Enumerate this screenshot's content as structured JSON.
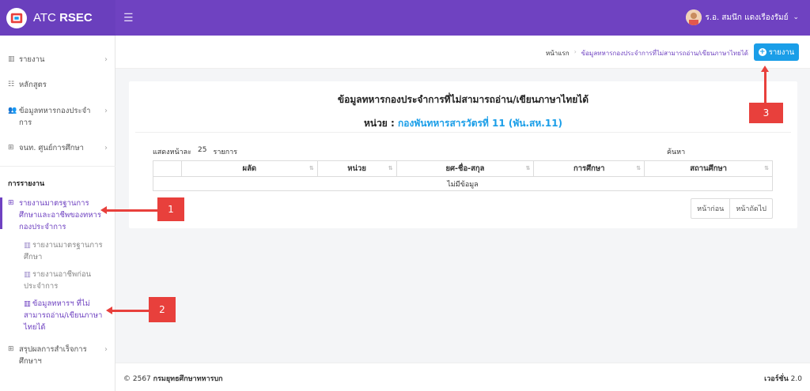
{
  "brand": {
    "name_prefix": "ATC ",
    "name_bold": "RSEC"
  },
  "user": {
    "name": "ร.อ. สมนึก แดงเรืองรัมย์"
  },
  "sidebar": {
    "items": [
      {
        "label": "รายงาน"
      },
      {
        "label": "หลักสูตร"
      },
      {
        "label": "ข้อมูลทหารกองประจำการ"
      },
      {
        "label": "จนท. ศูนย์การศึกษา"
      }
    ],
    "section_title": "การรายงาน",
    "active_item": "รายงานมาตรฐานการศึกษาและอาชีพของทหารกองประจำการ",
    "sub_items": [
      {
        "label": "รายงานมาตรฐานการศึกษา"
      },
      {
        "label": "รายงานอาชีพก่อนประจำการ"
      },
      {
        "label": "ข้อมูลทหารฯ ที่ไม่สามารถอ่าน/เขียนภาษาไทยได้"
      }
    ],
    "last_item": "สรุปผลการสำเร็จการศึกษาฯ"
  },
  "breadcrumb": {
    "home": "หน้าแรก",
    "current": "ข้อมูลทหารกองประจำการที่ไม่สามารถอ่าน/เขียนภาษาไทยได้"
  },
  "report_button": "รายงาน",
  "card": {
    "title": "ข้อมูลทหารกองประจำการที่ไม่สามารถอ่าน/เขียนภาษาไทยได้",
    "unit_label": "หน่วย : ",
    "unit_value": "กองพันทหารสารวัตรที่ 11 (พัน.สห.11)",
    "show_prefix": "แสดงหน้าละ",
    "show_value": "25",
    "show_suffix": "รายการ",
    "search_label": "ค้นหา",
    "columns": [
      "",
      "ผลัด",
      "หน่วย",
      "ยศ-ชื่อ-สกุล",
      "การศึกษา",
      "สถานศึกษา"
    ],
    "empty_text": "ไม่มีข้อมูล",
    "prev": "หน้าก่อน",
    "next": "หน้าถัดไป"
  },
  "footer": {
    "copyright": "© 2567 ",
    "org": "กรมยุทธศึกษาทหารบก",
    "version_label": "เวอร์ชั่น",
    "version": " 2.0"
  },
  "callouts": [
    "1",
    "2",
    "3"
  ],
  "colors": {
    "primary": "#6f42c1",
    "accent": "#1a9ee8",
    "callout": "#e8403c"
  }
}
